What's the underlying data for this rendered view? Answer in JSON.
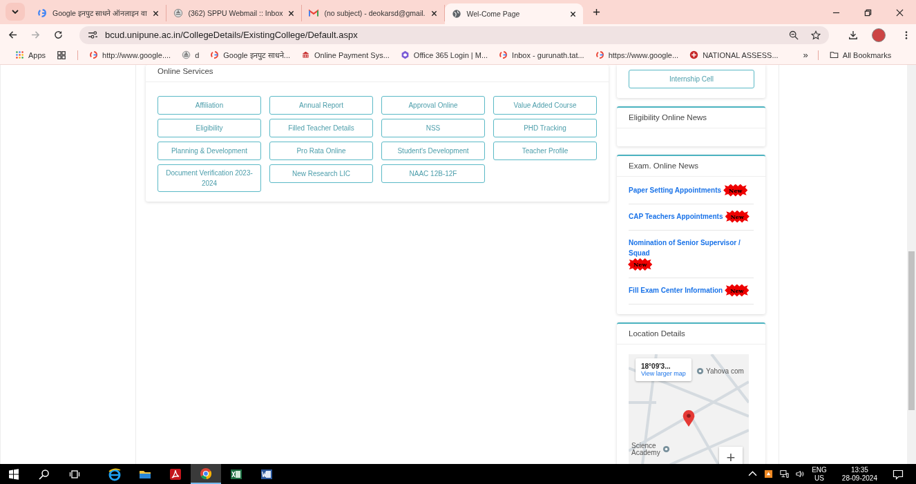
{
  "browser": {
    "tabs": [
      {
        "title": "Google इनपुट साधने ऑनलाइन वा",
        "selected": false
      },
      {
        "title": "(362) SPPU Webmail :: Inbox",
        "selected": false
      },
      {
        "title": "(no subject) - deokarsd@gmail.",
        "selected": false
      },
      {
        "title": "Wel-Come Page",
        "selected": true
      }
    ],
    "address": "bcud.unipune.ac.in/CollegeDetails/ExistingCollege/Default.aspx",
    "bookmarks": [
      {
        "label": "Apps"
      },
      {
        "label": "http://www.google...."
      },
      {
        "label": "d"
      },
      {
        "label": "Google इनपुट साधने..."
      },
      {
        "label": "Online Payment Sys..."
      },
      {
        "label": "Office 365 Login | M..."
      },
      {
        "label": "Inbox - gurunath.tat..."
      },
      {
        "label": "https://www.google..."
      },
      {
        "label": "NATIONAL ASSESS..."
      }
    ],
    "more": "»",
    "all_bookmarks": "All Bookmarks"
  },
  "services": {
    "title": "Online Services",
    "buttons": [
      "Affiliation",
      "Annual Report",
      "Approval Online",
      "Value Added Course",
      "Eligibility",
      "Filled Teacher Details",
      "NSS",
      "PHD Tracking",
      "Planning & Development",
      "Pro Rata Online",
      "Student's Development",
      "Teacher Profile",
      "Document Verification 2023-2024",
      "New Research LIC",
      "NAAC 12B-12F"
    ]
  },
  "internship_button": "Internship Cell",
  "eligibility_news": {
    "title": "Eligibility Online News"
  },
  "exam_news": {
    "title": "Exam. Online News",
    "items": [
      {
        "text": "Paper Setting Appointments",
        "badge": "New"
      },
      {
        "text": "CAP Teachers Appointments",
        "badge": "New"
      },
      {
        "text": "Nomination of Senior Supervisor / Squad",
        "badge": "New"
      },
      {
        "text": "Fill Exam Center Information",
        "badge": "New"
      }
    ]
  },
  "location": {
    "title": "Location Details",
    "coords": "18°09'3...",
    "link": "View larger map",
    "labels": [
      "Yahova com",
      "Science",
      "Academy"
    ],
    "zoom": "+"
  },
  "taskbar": {
    "apps": [
      {
        "selected": false
      },
      {
        "selected": false
      },
      {
        "selected": false
      },
      {
        "selected": true
      },
      {
        "selected": false
      },
      {
        "selected": false
      }
    ],
    "lang": "ENG",
    "region": "US",
    "time": "13:35",
    "date": "28-09-2024"
  }
}
